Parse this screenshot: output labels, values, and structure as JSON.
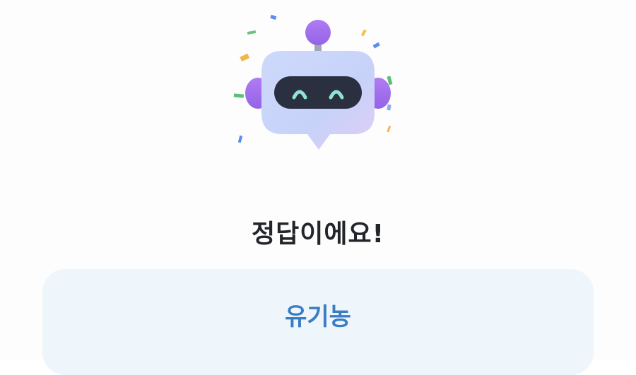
{
  "result": {
    "title": "정답이에요!",
    "icon": "robot-chat-mascot-icon"
  },
  "answer": {
    "text": "유기농"
  },
  "colors": {
    "title": "#222529",
    "answer_text": "#3a7dc4",
    "answer_card_bg": "#eff6fb",
    "robot_head_light": "#c9d6fb",
    "robot_head_accent": "#d9c9f8",
    "robot_visor": "#2b3040",
    "robot_eyes": "#8fe3d4",
    "robot_ears": "#a571ef"
  }
}
